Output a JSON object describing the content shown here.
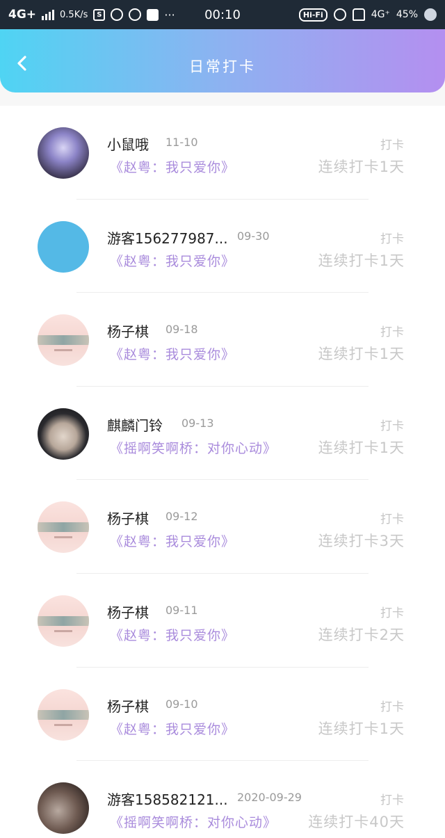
{
  "status_bar": {
    "network": "4G+",
    "speed": "0.5K/s",
    "time": "00:10",
    "hifi": "Hi-Fi",
    "network2": "4G⁺",
    "battery": "45%"
  },
  "header": {
    "title": "日常打卡"
  },
  "records": [
    {
      "name": "小鼠哦",
      "date": "11-10",
      "song": "《赵粤：我只爱你》",
      "label": "打卡",
      "streak": "连续打卡1天",
      "avatar": "purple"
    },
    {
      "name": "游客156277987...",
      "date": "09-30",
      "song": "《赵粤：我只爱你》",
      "label": "打卡",
      "streak": "连续打卡1天",
      "avatar": "fox"
    },
    {
      "name": "杨子棋",
      "date": "09-18",
      "song": "《赵粤：我只爱你》",
      "label": "打卡",
      "streak": "连续打卡1天",
      "avatar": "pink"
    },
    {
      "name": "麒麟门铃",
      "date": "09-13",
      "song": "《摇啊笑啊桥：对你心动》",
      "label": "打卡",
      "streak": "连续打卡1天",
      "avatar": "dark"
    },
    {
      "name": "杨子棋",
      "date": "09-12",
      "song": "《赵粤：我只爱你》",
      "label": "打卡",
      "streak": "连续打卡3天",
      "avatar": "pink"
    },
    {
      "name": "杨子棋",
      "date": "09-11",
      "song": "《赵粤：我只爱你》",
      "label": "打卡",
      "streak": "连续打卡2天",
      "avatar": "pink"
    },
    {
      "name": "杨子棋",
      "date": "09-10",
      "song": "《赵粤：我只爱你》",
      "label": "打卡",
      "streak": "连续打卡1天",
      "avatar": "pink"
    },
    {
      "name": "游客158582121...",
      "date": "2020-09-29",
      "song": "《摇啊笑啊桥：对你心动》",
      "label": "打卡",
      "streak": "连续打卡40天",
      "avatar": "photo"
    }
  ]
}
